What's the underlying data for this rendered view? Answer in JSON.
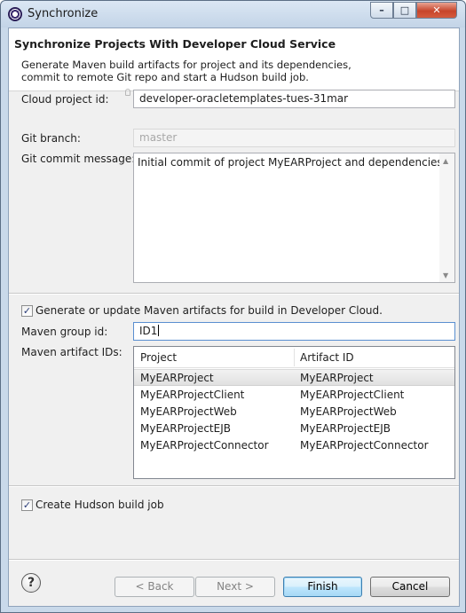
{
  "window": {
    "title": "Synchronize",
    "controls": {
      "minimize": "–",
      "maximize": "□",
      "close": "✕"
    }
  },
  "banner": {
    "title": "Synchronize Projects With Developer Cloud Service",
    "description_line1": "Generate Maven build artifacts for project and its dependencies,",
    "description_line2": "commit to remote Git repo and start a Hudson build job."
  },
  "form": {
    "cloud_project_label": "Cloud project id:",
    "cloud_project_value": "developer-oracletemplates-tues-31mar",
    "git_branch_label": "Git branch:",
    "git_branch_value": "master",
    "git_commit_label": "Git commit message:",
    "git_commit_value": "Initial commit of project MyEARProject and dependencies.",
    "maven_checkbox_label": "Generate or update Maven artifacts for build in Developer Cloud.",
    "maven_checkbox_checked": true,
    "maven_group_label": "Maven group id:",
    "maven_group_value": "ID1",
    "maven_artifacts_label": "Maven artifact IDs:",
    "hudson_checkbox_label": "Create Hudson build job",
    "hudson_checkbox_checked": true
  },
  "artifact_table": {
    "columns": [
      "Project",
      "Artifact ID"
    ],
    "rows": [
      {
        "project": "MyEARProject",
        "artifact": "MyEARProject",
        "selected": true
      },
      {
        "project": "MyEARProjectClient",
        "artifact": "MyEARProjectClient",
        "selected": false
      },
      {
        "project": "MyEARProjectWeb",
        "artifact": "MyEARProjectWeb",
        "selected": false
      },
      {
        "project": "MyEARProjectEJB",
        "artifact": "MyEARProjectEJB",
        "selected": false
      },
      {
        "project": "MyEARProjectConnector",
        "artifact": "MyEARProjectConnector",
        "selected": false
      }
    ]
  },
  "buttons": {
    "help": "?",
    "back": "< Back",
    "next": "Next >",
    "finish": "Finish",
    "cancel": "Cancel"
  },
  "icons": {
    "app": "eclipse-icon",
    "help": "help-icon",
    "content_assist": "lightbulb-icon",
    "check": "checkmark-icon"
  }
}
